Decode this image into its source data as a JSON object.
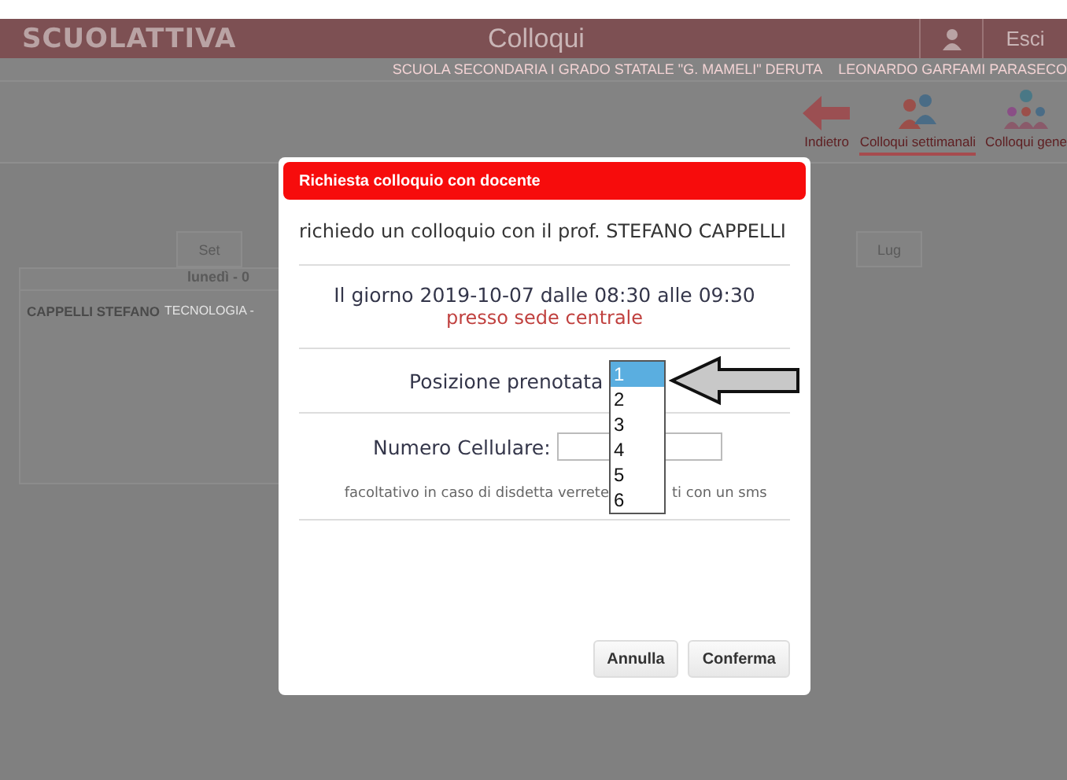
{
  "header": {
    "logo": "SCUOLATTIVA",
    "title": "Colloqui",
    "logout": "Esci"
  },
  "subheader": {
    "school": "SCUOLA SECONDARIA I GRADO STATALE \"G. MAMELI\" DERUTA",
    "user": "LEONARDO GARFAMI PARASECO"
  },
  "toolbar": [
    {
      "label": "Indietro",
      "kind": "back",
      "selected": false
    },
    {
      "label": "Colloqui settimanali",
      "kind": "weekly",
      "selected": true
    },
    {
      "label": "Colloqui gene",
      "kind": "general",
      "selected": false
    }
  ],
  "day_tabs": [
    {
      "label": "Set"
    },
    {
      "label": "Lug"
    }
  ],
  "day_panel": {
    "heading": "lunedì - 0",
    "rows": [
      {
        "teacher": "CAPPELLI STEFANO",
        "subject": "TECNOLOGIA -"
      }
    ]
  },
  "dialog": {
    "title": "Richiesta colloquio con docente",
    "request": "richiedo un colloquio con il prof. STEFANO CAPPELLI",
    "when": "Il giorno 2019-10-07 dalle 08:30 alle 09:30",
    "where": "presso sede centrale",
    "position": {
      "label": "Posizione prenotata",
      "options": [
        {
          "label": "1",
          "selected": true
        },
        {
          "label": "2",
          "selected": false
        },
        {
          "label": "3",
          "selected": false
        },
        {
          "label": "4",
          "selected": false
        },
        {
          "label": "5",
          "selected": false
        },
        {
          "label": "6",
          "selected": false
        }
      ]
    },
    "phone": {
      "label": "Numero Cellulare:"
    },
    "note_start": "facoltativo in caso di disdetta verrete",
    "note_end": "ti con un sms",
    "buttons": [
      "Annulla",
      "Conferma"
    ]
  }
}
